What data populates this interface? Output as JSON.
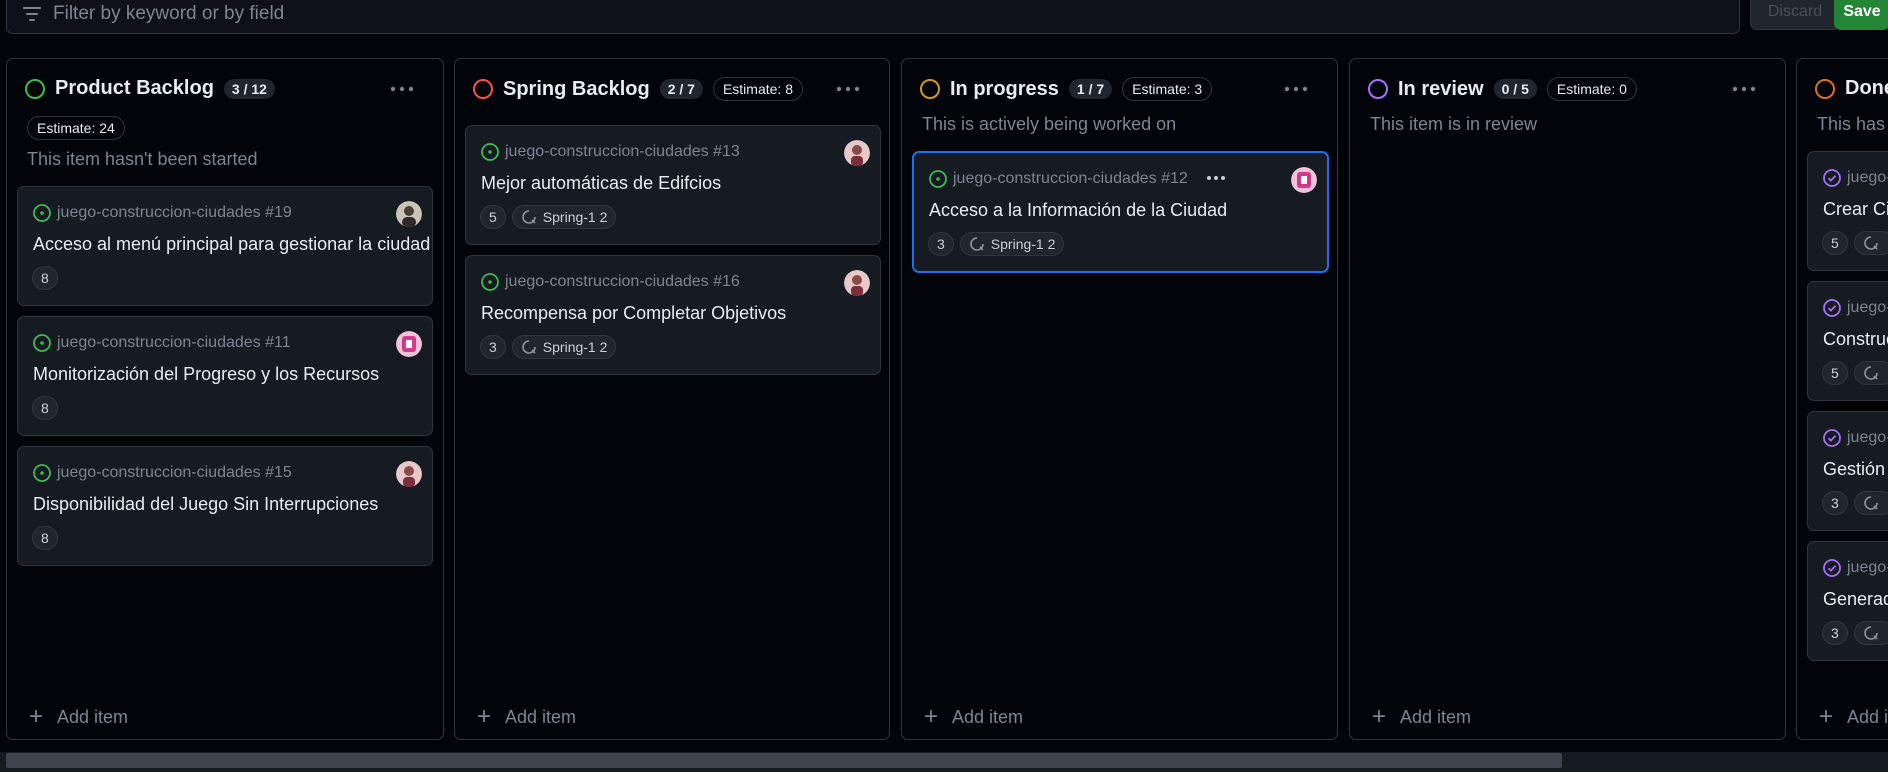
{
  "toolbar": {
    "filter_placeholder": "Filter by keyword or by field",
    "discard_label": "Discard",
    "save_label": "Save"
  },
  "colors": {
    "todo": "#3fb950",
    "backlog": "#f85149",
    "progress": "#d29922",
    "review": "#a371f7",
    "done": "#db6d28",
    "accent": "#1f6feb",
    "save": "#238636"
  },
  "columns": [
    {
      "title": "Product Backlog",
      "count": "3 / 12",
      "estimate": "Estimate: 24",
      "description": "This item hasn't been started",
      "add_label": "Add item",
      "cards": [
        {
          "repo": "juego-construccion-ciudades #19",
          "title": "Acceso al menú principal para gestionar la ciudad",
          "points": "8",
          "sprint": ""
        },
        {
          "repo": "juego-construccion-ciudades #11",
          "title": "Monitorización del Progreso y los Recursos",
          "points": "8",
          "sprint": ""
        },
        {
          "repo": "juego-construccion-ciudades #15",
          "title": "Disponibilidad del Juego Sin Interrupciones",
          "points": "8",
          "sprint": ""
        }
      ]
    },
    {
      "title": "Spring Backlog",
      "count": "2 / 7",
      "estimate": "Estimate: 8",
      "description": "",
      "add_label": "Add item",
      "cards": [
        {
          "repo": "juego-construccion-ciudades #13",
          "title": "Mejor automáticas de Edifcios",
          "points": "5",
          "sprint": "Spring-1 2"
        },
        {
          "repo": "juego-construccion-ciudades #16",
          "title": "Recompensa por Completar Objetivos",
          "points": "3",
          "sprint": "Spring-1 2"
        }
      ]
    },
    {
      "title": "In progress",
      "count": "1 / 7",
      "estimate": "Estimate: 3",
      "description": "This is actively being worked on",
      "add_label": "Add item",
      "cards": [
        {
          "repo": "juego-construccion-ciudades #12",
          "title": "Acceso a la Información de la Ciudad",
          "points": "3",
          "sprint": "Spring-1 2"
        }
      ]
    },
    {
      "title": "In review",
      "count": "0 / 5",
      "estimate": "Estimate: 0",
      "description": "This item is in review",
      "add_label": "Add item",
      "cards": []
    },
    {
      "title": "Done",
      "description": "This has been completed",
      "add_label": "Add item",
      "cards": [
        {
          "repo": "juego-",
          "title": "Crear Ciu",
          "points": "5"
        },
        {
          "repo": "juego-",
          "title": "Construc",
          "points": "5"
        },
        {
          "repo": "juego-",
          "title": "Gestión d",
          "points": "3"
        },
        {
          "repo": "juego-",
          "title": "Generad",
          "points": "3"
        }
      ]
    }
  ]
}
